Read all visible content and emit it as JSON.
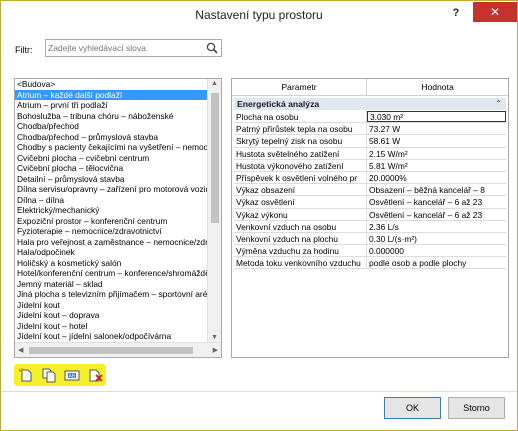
{
  "window": {
    "title": "Nastavení typu prostoru",
    "help_label": "?",
    "close_label": "✕"
  },
  "filter": {
    "label": "Filtr:",
    "placeholder": "Zadejte vyhledávací slova."
  },
  "space_types": [
    "<Budova>",
    "Atrium – každé další podlaží",
    "Atrium – první tři podlaží",
    "Bohoslužba – tribuna chóru – náboženské",
    "Chodba/přechod",
    "Chodba/přechod – průmyslová stavba",
    "Chodby s pacienty čekajícími na vyšetření – nemocnic",
    "Cvičební plocha – cvičební centrum",
    "Cvičební plocha – tělocvična",
    "Detailní – průmyslová stavba",
    "Dílna servisu/opravny – zařízení pro motorová vozidla",
    "Dílna – dílna",
    "Elektrický/mechanický",
    "Expoziční prostor – konferenční centrum",
    "Fyzioterapie – nemocnice/zdravotnictví",
    "Hala pro veřejnost a zaměstnance – nemocnice/zdrav",
    "Hala/odpočinek",
    "Holičský a kosmetický salón",
    "Hotel/konferenční centrum – konference/shromáždění",
    "Jemný materiál – sklad",
    "Jiná plocha s televizním přijímačem – sportovní aréna",
    "Jídelní kout",
    "Jídelní kout – doprava",
    "Jídelní kout – hotel",
    "Jídelní kout – jídelní salonek/odpočívárna",
    "Jídelní kout – motel",
    "Jídelní kout – občanská vybavenost"
  ],
  "selected_index": 1,
  "toolbar": {
    "icons": [
      "new-type-icon",
      "duplicate-icon",
      "rename-icon",
      "delete-icon"
    ]
  },
  "parameters": {
    "col_param": "Parametr",
    "col_value": "Hodnota",
    "section_title": "Energetická analýza",
    "collapse_glyph": "⌃",
    "rows": [
      {
        "name": "Plocha na osobu",
        "value": "3.030 m²"
      },
      {
        "name": "Patrný přírůstek tepla na osobu",
        "value": "73.27 W"
      },
      {
        "name": "Skrytý tepelný zisk na osobu",
        "value": "58.61 W"
      },
      {
        "name": "Hustota světelného zatížení",
        "value": "2.15 W/m²"
      },
      {
        "name": "Hustota výkonového zatížení",
        "value": "5.81 W/m²"
      },
      {
        "name": "Příspěvek k osvětlení volného pr",
        "value": "20.0000%"
      },
      {
        "name": "Výkaz obsazení",
        "value": "Obsazení – běžná kancelář – 8"
      },
      {
        "name": "Výkaz osvětlení",
        "value": "Osvětlení – kancelář – 6 až 23"
      },
      {
        "name": "Výkaz výkonu",
        "value": "Osvětlení – kancelář – 6 až 23"
      },
      {
        "name": "Venkovní vzduch na osobu",
        "value": "2.36 L/s"
      },
      {
        "name": "Venkovní vzduch na plochu",
        "value": "0.30 L/(s·m²)"
      },
      {
        "name": "Výměna vzduchu za hodinu",
        "value": "0.000000"
      },
      {
        "name": "Metoda toku venkovního vzduchu",
        "value": "podle osob a podle plochy"
      }
    ]
  },
  "buttons": {
    "ok_label": "OK",
    "cancel_label": "Storno"
  },
  "colors": {
    "selection": "#3399ff",
    "section_bar": "#dfe7f0",
    "highlight": "#f4f12a",
    "close": "#c7312f"
  }
}
